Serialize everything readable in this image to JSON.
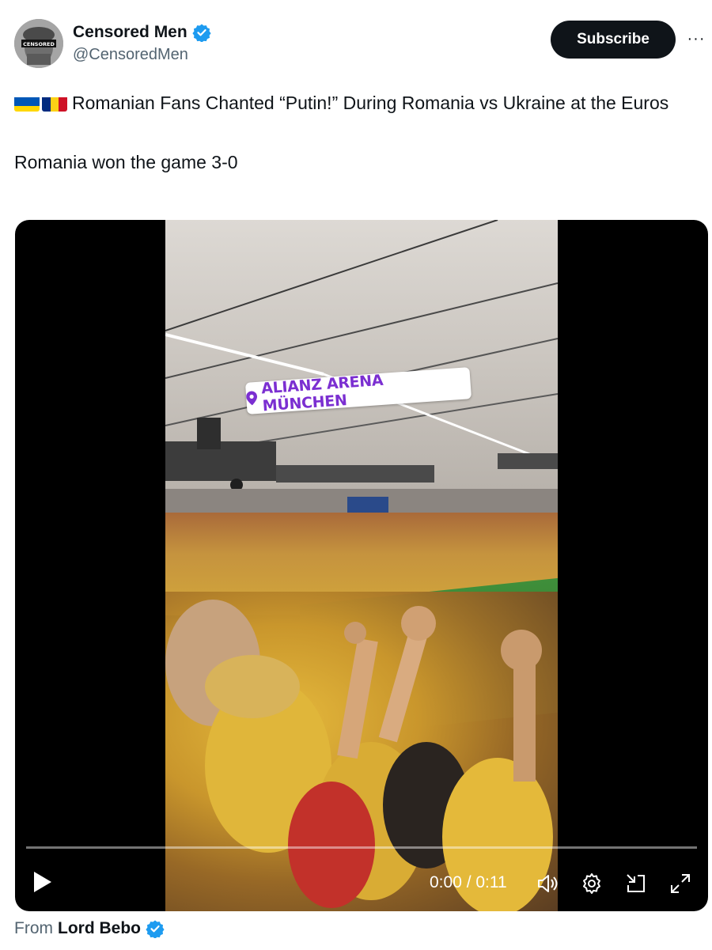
{
  "author": {
    "display_name": "Censored Men",
    "handle": "@CensoredMen",
    "avatar_icon": "censored-men-avatar",
    "avatar_text": "CENSORED",
    "verified_color": "#1d9bf0"
  },
  "actions": {
    "subscribe_label": "Subscribe",
    "more_label": "···"
  },
  "tweet": {
    "line1": "Romanian Fans Chanted “Putin!” During Romania vs Ukraine at the Euros",
    "line2": "Romania won the game 3-0",
    "flags": [
      "ukraine-flag",
      "romania-flag"
    ]
  },
  "video": {
    "location_sticker": "ALIANZ ARENA MÜNCHEN",
    "progress": 0,
    "time_display": "0:00 / 0:11",
    "icons": [
      "play-icon",
      "volume-icon",
      "settings-icon",
      "pip-icon",
      "fullscreen-icon"
    ]
  },
  "footer": {
    "from_label": "From",
    "source_name": "Lord Bebo"
  }
}
